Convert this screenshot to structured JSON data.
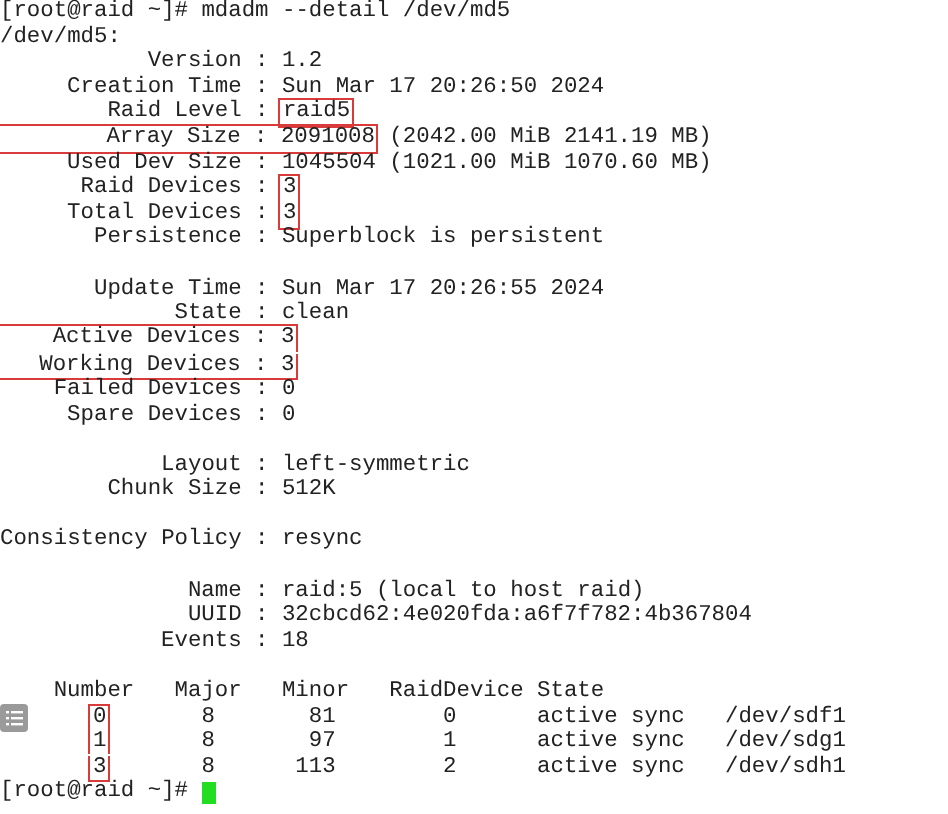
{
  "command_line": {
    "prompt": "[root@raid ~]#",
    "command": "mdadm --detail /dev/md5"
  },
  "device_path": "/dev/md5:",
  "fields": [
    {
      "label": "Version :",
      "value": "1.2"
    },
    {
      "label": "Creation Time :",
      "value": "Sun Mar 17 20:26:50 2024"
    },
    {
      "label": "Raid Level :",
      "value": "raid5",
      "value_boxed": true
    },
    {
      "label": "Array Size :",
      "value": "2091008",
      "extra": "(2042.00 MiB 2141.19 MB)",
      "line_boxed": true
    },
    {
      "label": "Used Dev Size :",
      "value": "1045504",
      "extra": "(1021.00 MiB 1070.60 MB)"
    },
    {
      "label": "Raid Devices :",
      "value": "3",
      "value_boxed": true
    },
    {
      "label": "Total Devices :",
      "value": "3",
      "value_boxed": true
    },
    {
      "label": "Persistence :",
      "value": "Superblock is persistent"
    },
    {
      "label": "Update Time :",
      "value": "Sun Mar 17 20:26:55 2024",
      "blank_line_before": true
    },
    {
      "label": "State :",
      "value": "clean"
    },
    {
      "label": "Active Devices :",
      "value": "3",
      "line_boxed": true
    },
    {
      "label": "Working Devices :",
      "value": "3",
      "line_boxed": true
    },
    {
      "label": "Failed Devices :",
      "value": "0"
    },
    {
      "label": "Spare Devices :",
      "value": "0"
    },
    {
      "label": "Layout :",
      "value": "left-symmetric",
      "blank_line_before": true
    },
    {
      "label": "Chunk Size :",
      "value": "512K"
    },
    {
      "label": "Consistency Policy :",
      "value": "resync",
      "blank_line_before": true
    },
    {
      "label": "Name :",
      "value": "raid:5",
      "extra": "(local to host raid)",
      "blank_line_before": true
    },
    {
      "label": "UUID :",
      "value": "32cbcd62:4e020fda:a6f7f782:4b367804"
    },
    {
      "label": "Events :",
      "value": "18"
    }
  ],
  "table": {
    "columns": [
      "Number",
      "Major",
      "Minor",
      "RaidDevice",
      "State"
    ],
    "rows": [
      {
        "cells": [
          "0",
          "8",
          "81",
          "0",
          "active sync",
          "/dev/sdf1"
        ],
        "number_boxed": true
      },
      {
        "cells": [
          "1",
          "8",
          "97",
          "1",
          "active sync",
          "/dev/sdg1"
        ],
        "number_boxed": true
      },
      {
        "cells": [
          "3",
          "8",
          "113",
          "2",
          "active sync",
          "/dev/sdh1"
        ],
        "number_boxed": true
      }
    ]
  },
  "final_prompt": "[root@raid ~]#",
  "cursor": true
}
